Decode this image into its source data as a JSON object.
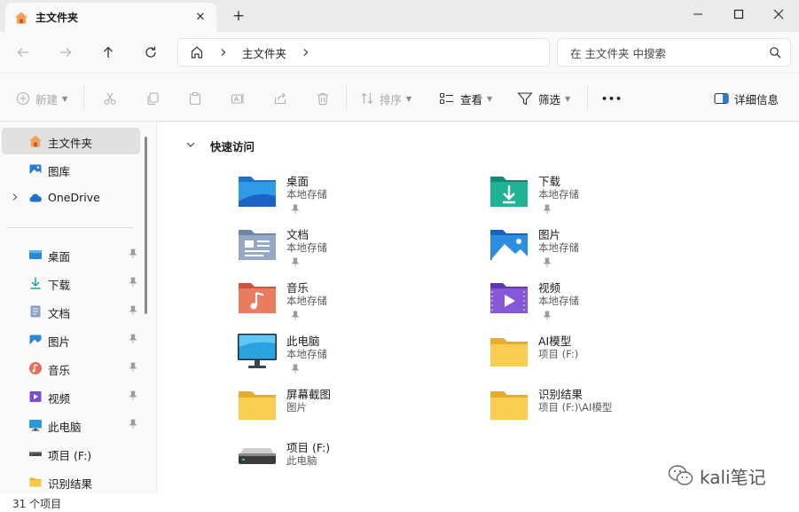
{
  "window": {
    "tab_title": "主文件夹",
    "tab_close": "✕",
    "new_tab": "+"
  },
  "nav": {
    "breadcrumb": "主文件夹",
    "search_placeholder": "在 主文件夹 中搜索"
  },
  "commands": {
    "new": "新建",
    "sort": "排序",
    "view": "查看",
    "filter": "筛选",
    "more": "•••",
    "details": "详细信息"
  },
  "sidebar": {
    "items": [
      {
        "label": "主文件夹",
        "icon": "home-icon"
      },
      {
        "label": "图库",
        "icon": "gallery-icon"
      },
      {
        "label": "OneDrive",
        "icon": "onedrive-icon"
      },
      {
        "label": "桌面",
        "icon": "desktop-icon"
      },
      {
        "label": "下载",
        "icon": "download-icon"
      },
      {
        "label": "文档",
        "icon": "documents-icon"
      },
      {
        "label": "图片",
        "icon": "pictures-icon"
      },
      {
        "label": "音乐",
        "icon": "music-icon"
      },
      {
        "label": "视频",
        "icon": "videos-icon"
      },
      {
        "label": "此电脑",
        "icon": "computer-icon"
      },
      {
        "label": "项目 (F:)",
        "icon": "drive-icon"
      },
      {
        "label": "识别结果",
        "icon": "folder-icon"
      }
    ]
  },
  "main": {
    "section_title": "快速访问",
    "items": [
      {
        "name": "桌面",
        "sub": "本地存储",
        "icon": "desktop-folder-icon"
      },
      {
        "name": "下载",
        "sub": "本地存储",
        "icon": "download-folder-icon"
      },
      {
        "name": "文档",
        "sub": "本地存储",
        "icon": "documents-folder-icon"
      },
      {
        "name": "图片",
        "sub": "本地存储",
        "icon": "pictures-folder-icon"
      },
      {
        "name": "音乐",
        "sub": "本地存储",
        "icon": "music-folder-icon"
      },
      {
        "name": "视频",
        "sub": "本地存储",
        "icon": "videos-folder-icon"
      },
      {
        "name": "此电脑",
        "sub": "本地存储",
        "icon": "monitor-icon"
      },
      {
        "name": "AI模型",
        "sub": "项目 (F:)",
        "icon": "folder-icon"
      },
      {
        "name": "屏幕截图",
        "sub": "图片",
        "icon": "folder-icon"
      },
      {
        "name": "识别结果",
        "sub": "项目 (F:)\\AI模型",
        "icon": "folder-icon"
      },
      {
        "name": "项目 (F:)",
        "sub": "此电脑",
        "icon": "drive-icon"
      }
    ]
  },
  "status": {
    "item_count": "31 个项目"
  },
  "watermark": {
    "text": "kali笔记"
  },
  "colors": {
    "folder_yellow": "#f8c846",
    "accent_blue": "#1e6fd0",
    "teal": "#1aa58f",
    "music": "#e0705a",
    "video": "#7a4fc9",
    "selected_bg": "#e0e0e0"
  }
}
